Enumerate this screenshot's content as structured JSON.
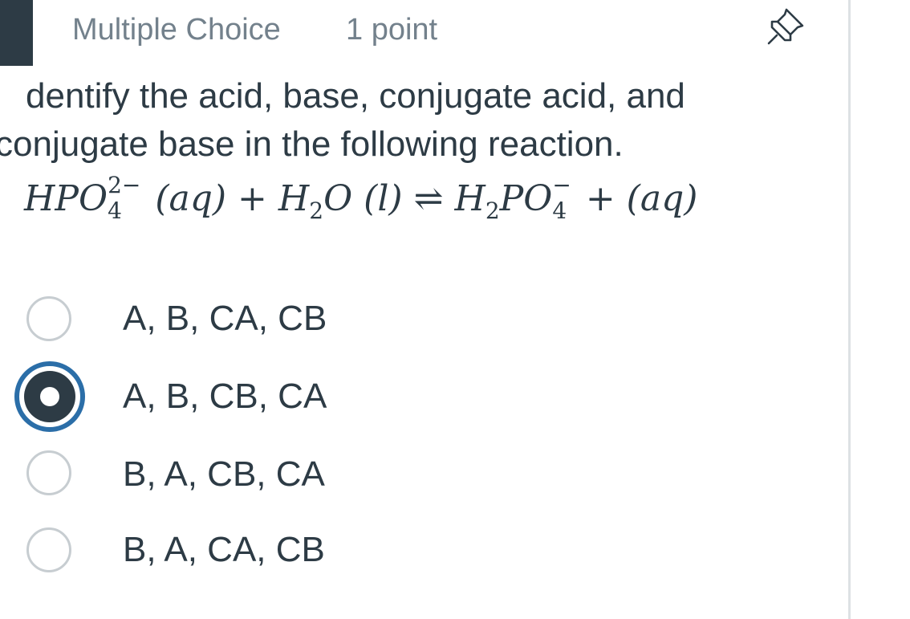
{
  "header": {
    "question_type": "Multiple Choice",
    "points": "1 point",
    "pin_icon": "pushpin-icon"
  },
  "question": {
    "line1": "dentify the acid, base, conjugate acid, and",
    "line2": "conjugate base in the following reaction.",
    "equation": {
      "t1": "HPO",
      "t1_sup": "2−",
      "t1_sub": "4",
      "t2": "(aq) + H",
      "t2_sub": "2",
      "t3": "O (l)",
      "arrow": "⇌",
      "t4": "H",
      "t4_sub": "2",
      "t5": "PO",
      "t5_sup": "−",
      "t5_sub": "4",
      "t6": "+ (aq)"
    }
  },
  "options": [
    {
      "label": "A, B, CA, CB",
      "selected": false
    },
    {
      "label": "A, B, CB, CA",
      "selected": true
    },
    {
      "label": "B, A, CB, CA",
      "selected": false
    },
    {
      "label": "B, A, CA, CB",
      "selected": false
    }
  ],
  "colors": {
    "text": "#2d3b45",
    "muted": "#73818c",
    "radio_border": "#c7cdd1",
    "selected_ring": "#2b6ea8"
  }
}
